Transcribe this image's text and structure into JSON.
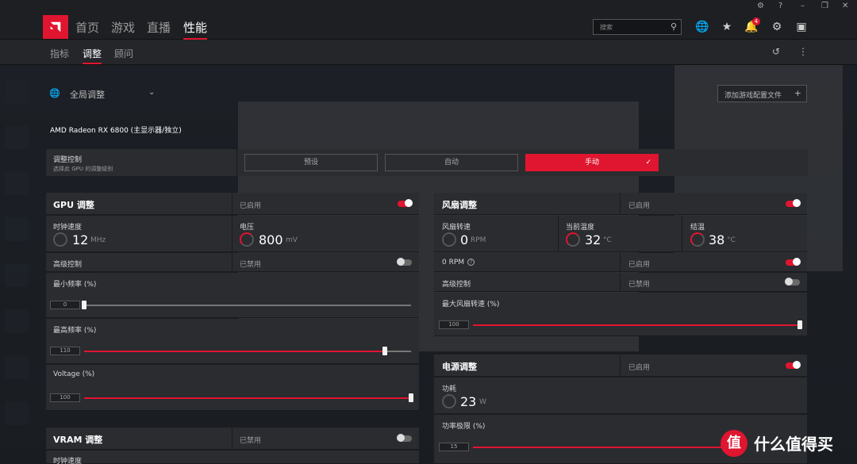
{
  "nav": {
    "tabs": [
      "首页",
      "游戏",
      "直播",
      "性能"
    ]
  },
  "search": {
    "placeholder": "搜索"
  },
  "notifications": {
    "count": "4"
  },
  "subnav": {
    "tabs": [
      "指标",
      "调整",
      "顾问"
    ]
  },
  "profile": {
    "label": "全局调整",
    "add_profile": "添加游戏配置文件"
  },
  "gpu_name": "AMD Radeon RX 6800 (主显示器/独立)",
  "tuning_control": {
    "title": "调整控制",
    "subtitle": "选择此 GPU 的调整级别",
    "options": [
      "预设",
      "自动",
      "手动"
    ],
    "selected": "手动"
  },
  "gpu_tuning": {
    "title": "GPU 调整",
    "state": "已启用",
    "clock": {
      "label": "时钟速度",
      "value": "12",
      "unit": "MHz"
    },
    "voltage": {
      "label": "电压",
      "value": "800",
      "unit": "mV"
    },
    "advanced": {
      "label": "高级控制",
      "state": "已禁用"
    },
    "min_freq": {
      "label": "最小频率 (%)",
      "value": "0",
      "percent": 0
    },
    "max_freq": {
      "label": "最高频率 (%)",
      "value": "110",
      "percent": 92
    },
    "voltage_pct": {
      "label": "Voltage (%)",
      "value": "100",
      "percent": 100
    }
  },
  "vram_tuning": {
    "title": "VRAM 调整",
    "state": "已禁用",
    "clock_label": "时钟速度"
  },
  "fan_tuning": {
    "title": "风扇调整",
    "state": "已启用",
    "fan_speed": {
      "label": "风扇转速",
      "value": "0",
      "unit": "RPM"
    },
    "current_temp": {
      "label": "当前温度",
      "value": "32",
      "unit": "°C"
    },
    "junction_temp": {
      "label": "结温",
      "value": "38",
      "unit": "°C"
    },
    "zero_rpm": {
      "label": "0 RPM",
      "state": "已启用"
    },
    "advanced": {
      "label": "高级控制",
      "state": "已禁用"
    },
    "max_fan": {
      "label": "最大风扇转速 (%)",
      "value": "100",
      "percent": 100
    }
  },
  "power_tuning": {
    "title": "电源调整",
    "state": "已启用",
    "power": {
      "label": "功耗",
      "value": "23",
      "unit": "W"
    },
    "power_limit": {
      "label": "功率极限 (%)",
      "value": "15"
    }
  },
  "watermark": {
    "text": "什么值得买",
    "logo": "值"
  },
  "colors": {
    "accent": "#e0152f",
    "panel": "#2a2c30",
    "background": "#1a1c1f"
  }
}
